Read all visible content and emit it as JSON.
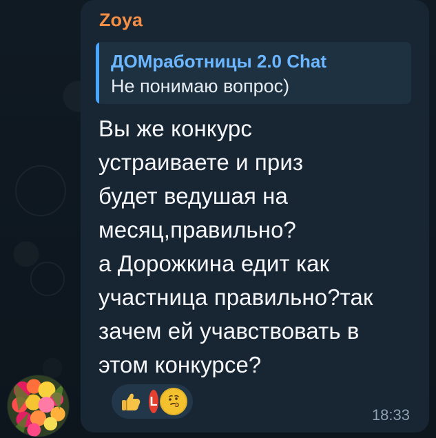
{
  "message": {
    "sender": "Zoya",
    "reply": {
      "title": "ДОМработницы 2.0 Chat",
      "text": "Не понимаю вопрос)"
    },
    "lines": [
      "Вы же конкурс",
      "устраиваете и приз",
      "будет ведушая на",
      "месяц,правильно?",
      "а Дорожкина едит как",
      "участница правильно?так",
      "зачем ей учавствовать в",
      "этом конкурсе?"
    ],
    "reactions": {
      "thumb_icon": "thumbs-up-icon",
      "user_initial": "L",
      "emoji_icon": "thinking-face-icon"
    },
    "time": "18:33"
  },
  "avatar": {
    "icon": "flowers-avatar"
  },
  "colors": {
    "background": "#0e1621",
    "bubble": "#182533",
    "sender": "#f48f45",
    "reply_accent": "#4aa7ff",
    "reply_title": "#6cb7ff",
    "text": "#f5f7fa",
    "timestamp": "#8fa2b3"
  }
}
